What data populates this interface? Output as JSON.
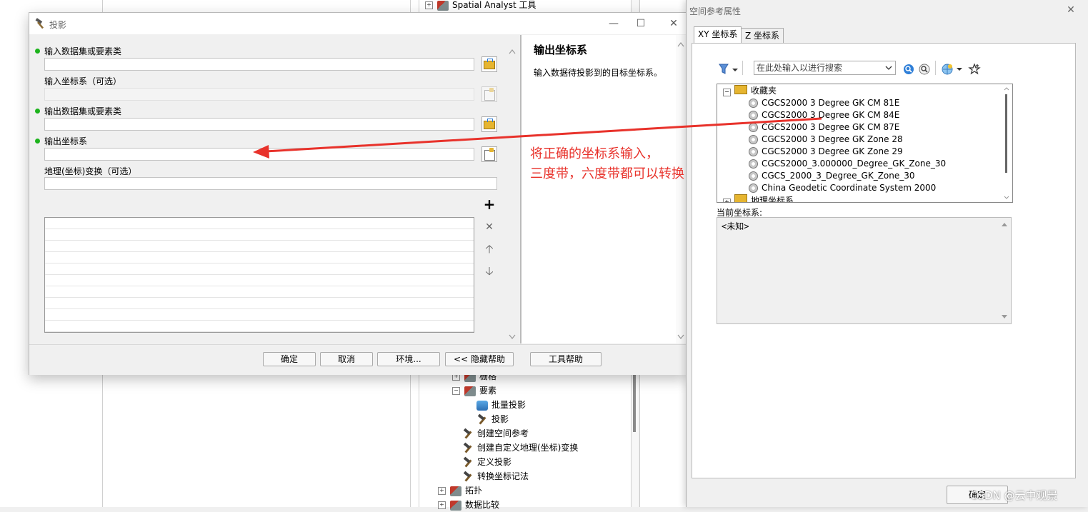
{
  "background": {
    "top_tree_label": "Spatial Analyst 工具",
    "tree_items": [
      {
        "label": "栅格",
        "indent": 1,
        "expander": "⊞",
        "icon": "toolbox-icon"
      },
      {
        "label": "要素",
        "indent": 1,
        "expander": "⊟",
        "icon": "toolbox-icon"
      },
      {
        "label": "批量投影",
        "indent": 2,
        "expander": "",
        "icon": "script-icon"
      },
      {
        "label": "投影",
        "indent": 2,
        "expander": "",
        "icon": "hammer-icon"
      },
      {
        "label": "创建空间参考",
        "indent": 1,
        "expander": "",
        "icon": "hammer-icon"
      },
      {
        "label": "创建自定义地理(坐标)变换",
        "indent": 1,
        "expander": "",
        "icon": "hammer-icon"
      },
      {
        "label": "定义投影",
        "indent": 1,
        "expander": "",
        "icon": "hammer-icon"
      },
      {
        "label": "转换坐标记法",
        "indent": 1,
        "expander": "",
        "icon": "hammer-icon"
      },
      {
        "label": "拓扑",
        "indent": 0,
        "expander": "⊞",
        "icon": "toolbox-icon"
      },
      {
        "label": "数据比较",
        "indent": 0,
        "expander": "⊞",
        "icon": "toolbox-icon"
      }
    ]
  },
  "project_dialog": {
    "title": "投影",
    "fields": {
      "input_dataset_label": "输入数据集或要素类",
      "input_cs_label": "输入坐标系（可选）",
      "output_dataset_label": "输出数据集或要素类",
      "output_cs_label": "输出坐标系",
      "geo_transform_label": "地理(坐标)变换（可选）"
    },
    "help": {
      "title": "输出坐标系",
      "text": "输入数据待投影到的目标坐标系。"
    },
    "buttons": {
      "ok": "确定",
      "cancel": "取消",
      "env": "环境...",
      "hide_help": "<< 隐藏帮助",
      "tool_help": "工具帮助"
    }
  },
  "spatial_ref": {
    "title": "空间参考属性",
    "tabs": [
      "XY 坐标系",
      "Z 坐标系"
    ],
    "search_placeholder": "在此处输入以进行搜索",
    "favorites_label": "收藏夹",
    "next_folder_label": "地理坐标系",
    "coordinate_systems": [
      "CGCS2000 3 Degree GK CM 81E",
      "CGCS2000 3 Degree GK CM 84E",
      "CGCS2000 3 Degree GK CM 87E",
      "CGCS2000 3 Degree GK Zone 28",
      "CGCS2000 3 Degree GK Zone 29",
      "CGCS2000_3.000000_Degree_GK_Zone_30",
      "CGCS_2000_3_Degree_GK_Zone_30",
      "China Geodetic Coordinate System 2000"
    ],
    "current_label": "当前坐标系:",
    "current_value": "<未知>",
    "ok": "确定"
  },
  "annotation": {
    "line1": "将正确的坐标系输入，",
    "line2": "三度带，六度带都可以转换",
    "color": "#e8322b"
  },
  "watermark": "CSDN @云中观景"
}
